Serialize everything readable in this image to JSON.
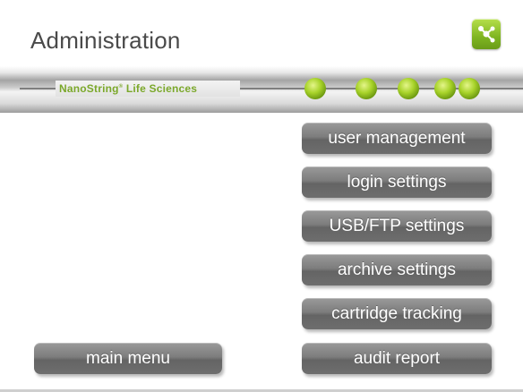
{
  "header": {
    "title": "Administration",
    "app_icon": "network-app-icon",
    "accent_color": "#8cc63f"
  },
  "banner": {
    "brand": "NanoString",
    "brand_mark": "®",
    "brand_suffix": " Life Sciences",
    "brand_color": "#7ba82b",
    "indicator_dots": 5,
    "dot_color": "#a8d32a"
  },
  "menu": {
    "items": [
      {
        "label": "user management"
      },
      {
        "label": "login settings"
      },
      {
        "label": "USB/FTP settings"
      },
      {
        "label": "archive settings"
      },
      {
        "label": "cartridge tracking"
      },
      {
        "label": "audit report"
      }
    ]
  },
  "footer": {
    "main_menu_label": "main menu"
  }
}
